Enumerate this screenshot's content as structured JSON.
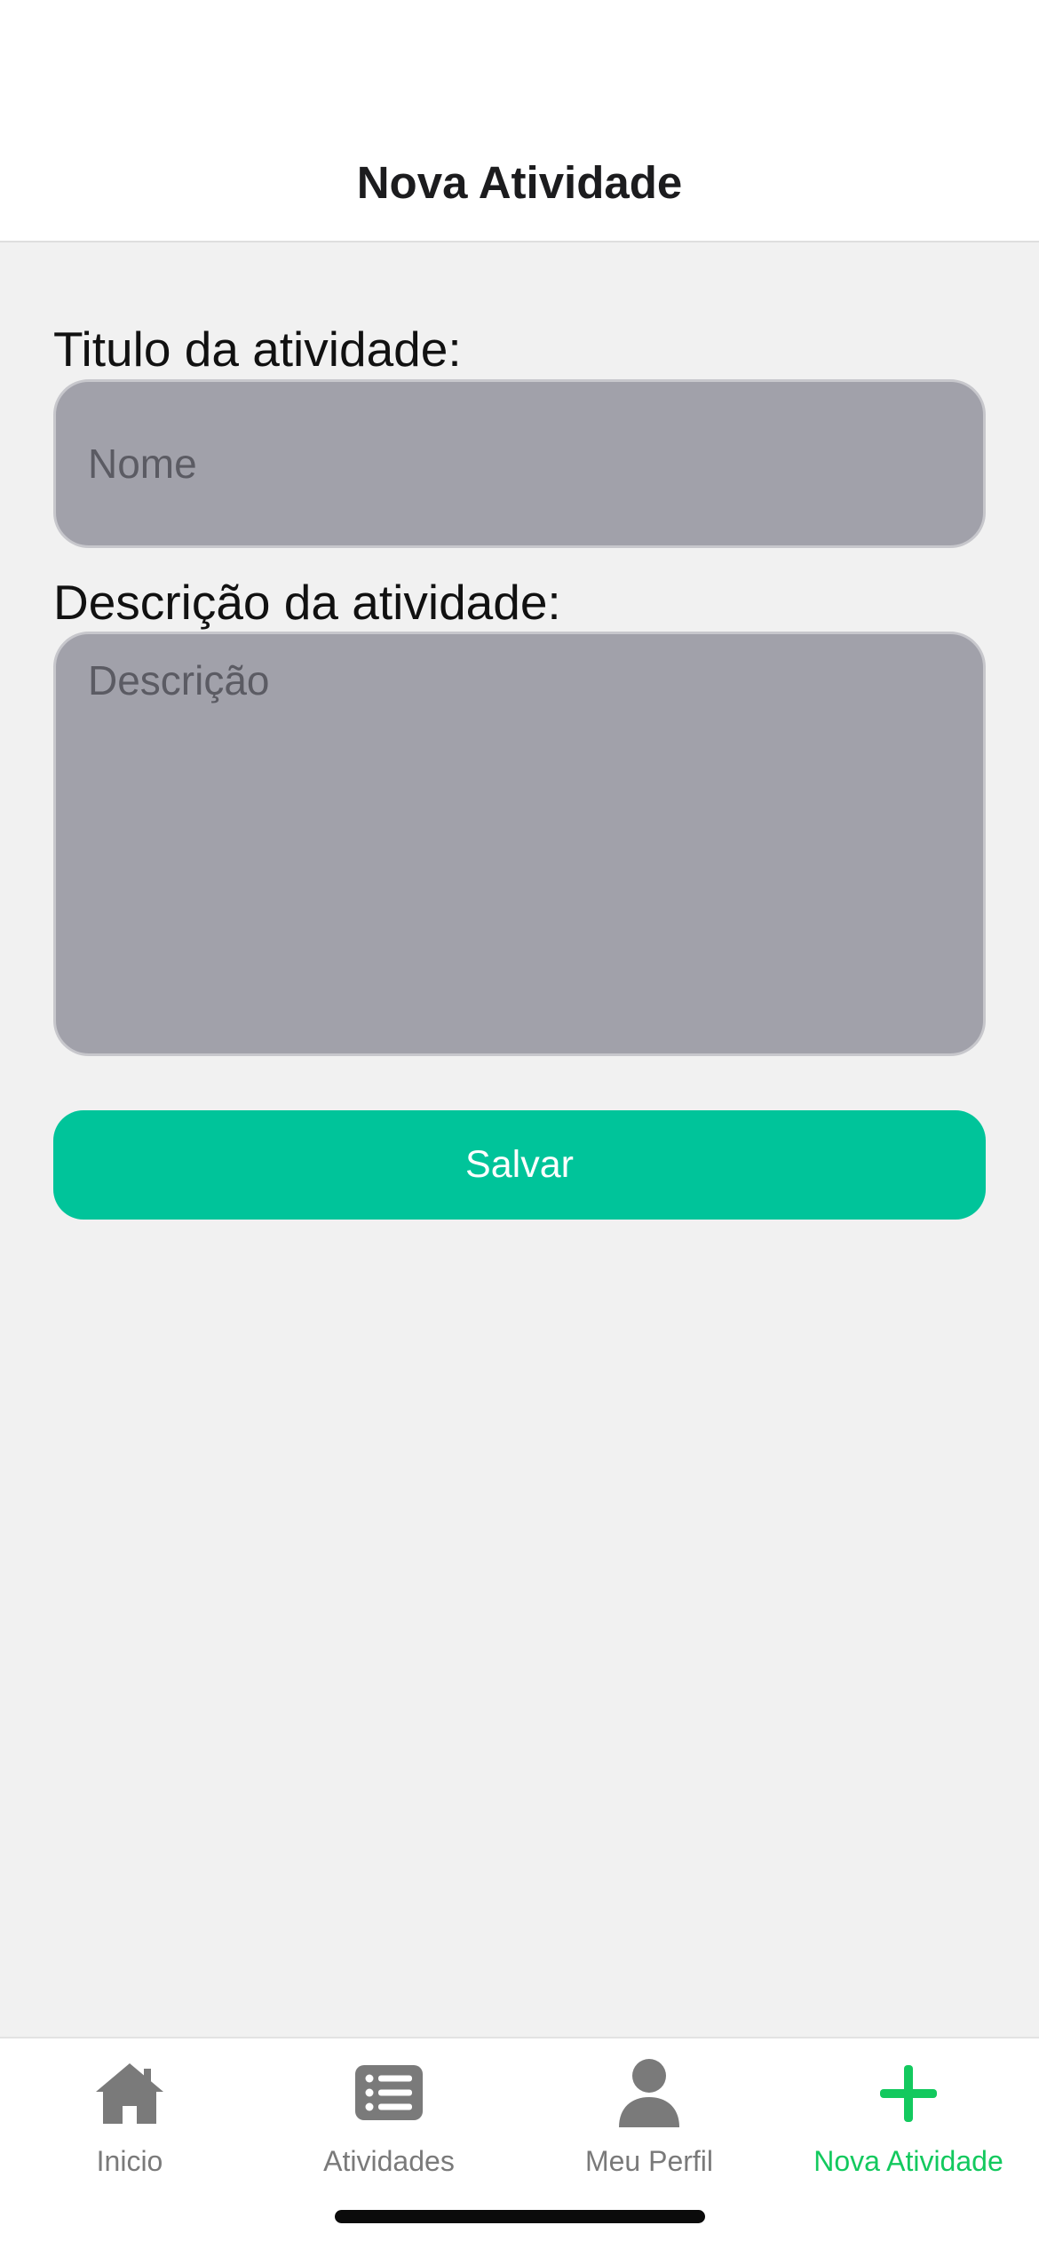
{
  "header": {
    "title": "Nova Atividade"
  },
  "form": {
    "title_label": "Titulo da atividade:",
    "title_placeholder": "Nome",
    "title_value": "",
    "description_label": "Descrição da atividade:",
    "description_placeholder": "Descrição",
    "description_value": "",
    "save_label": "Salvar"
  },
  "tabbar": {
    "active_index": 3,
    "items": [
      {
        "label": "Inicio",
        "icon": "home-icon"
      },
      {
        "label": "Atividades",
        "icon": "list-icon"
      },
      {
        "label": "Meu Perfil",
        "icon": "person-icon"
      },
      {
        "label": "Nova Atividade",
        "icon": "plus-icon"
      }
    ]
  },
  "colors": {
    "accent_button": "#00c49a",
    "active_tab": "#13c95e",
    "inactive_tab": "#7a7a7a",
    "input_background": "#a1a1aa"
  }
}
